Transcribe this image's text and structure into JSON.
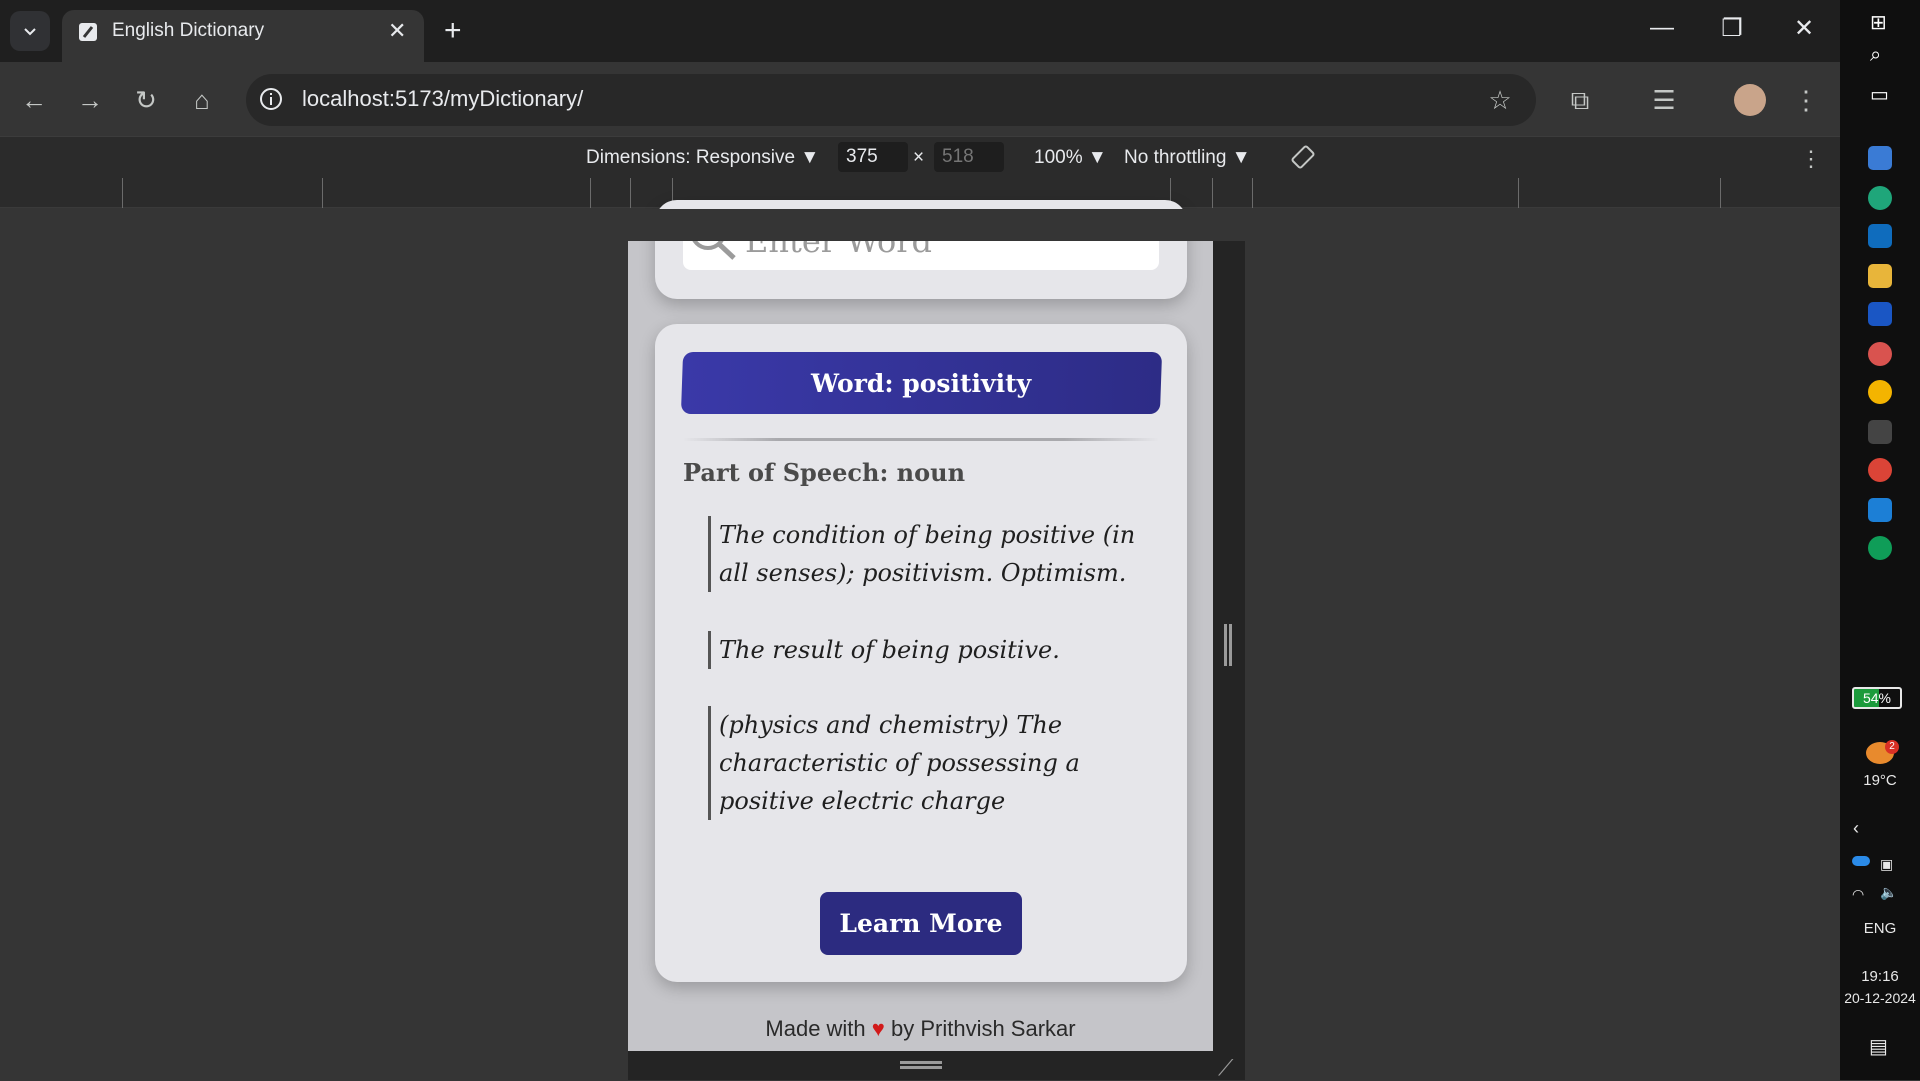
{
  "browser": {
    "tab_title": "English Dictionary",
    "tab_close": "✕",
    "new_tab": "+",
    "url": "localhost:5173/myDictionary/",
    "win_minimize": "—",
    "win_restore": "❐",
    "win_close": "✕"
  },
  "devtools": {
    "dimensions_label": "Dimensions: Responsive ▼",
    "width": "375",
    "times": "×",
    "height_placeholder": "518",
    "zoom": "100% ▼",
    "throttle": "No throttling ▼"
  },
  "page": {
    "search_placeholder": "Enter Word",
    "word_banner": "Word: positivity",
    "part_of_speech": "Part of Speech: noun",
    "definitions": [
      "The condition of being positive (in all senses); positivism. Optimism.",
      "The result of being positive.",
      "(physics and chemistry) The characteristic of possessing a positive electric charge"
    ],
    "learn_more": "Learn More",
    "footer_before": "Made with",
    "footer_heart": "♥",
    "footer_after": "by Prithvish Sarkar"
  },
  "system": {
    "battery": "54%",
    "temperature": "19°C",
    "weather_badge": "2",
    "language": "ENG",
    "time": "19:16",
    "date": "20-12-2024"
  },
  "colors": {
    "accent": "#2d2c86",
    "heart": "#d21a1a"
  }
}
